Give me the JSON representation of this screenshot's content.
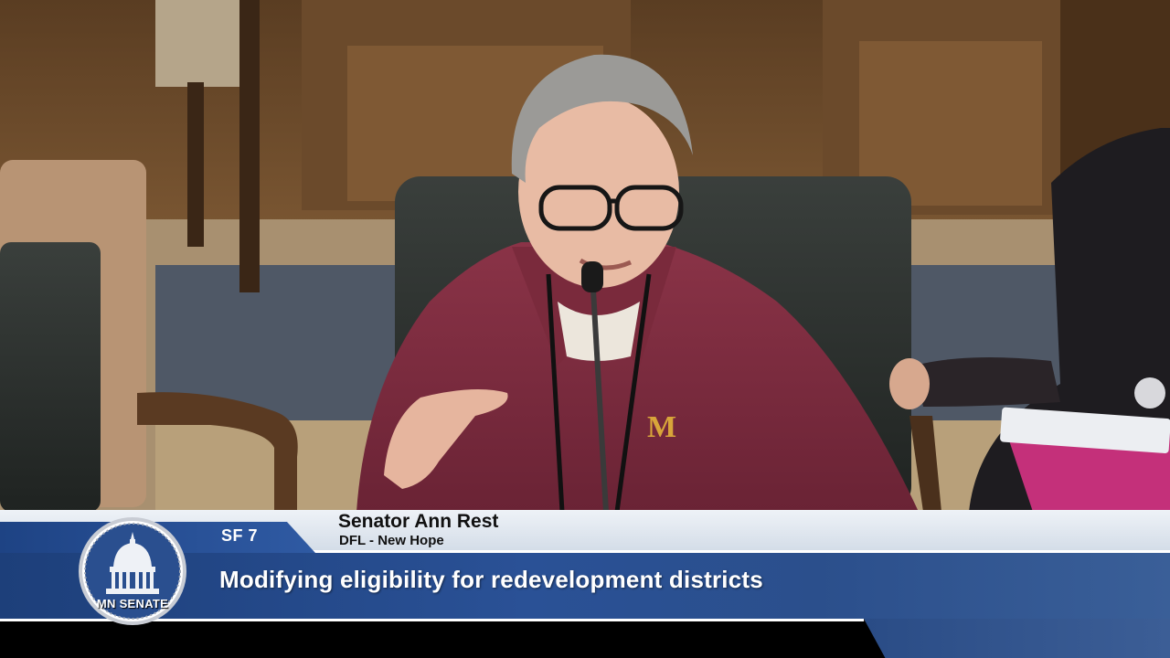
{
  "lower_third": {
    "bill_id": "SF 7",
    "speaker_name": "Senator Ann Rest",
    "speaker_party": "DFL - New Hope",
    "topic": "Modifying eligibility for redevelopment districts"
  },
  "logo": {
    "text": "MN SENATE"
  },
  "colors": {
    "banner_blue": "#2a5196",
    "banner_light": "#e6ecf3",
    "sweater_maroon": "#7a2a3c"
  }
}
